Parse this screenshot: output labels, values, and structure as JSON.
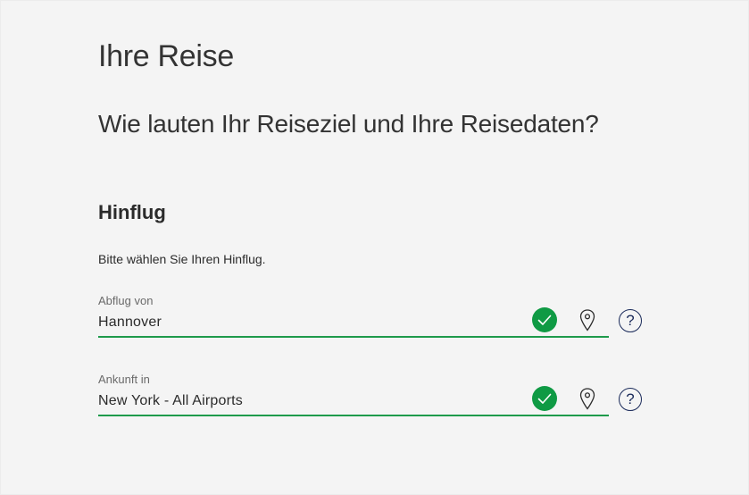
{
  "page": {
    "title": "Ihre Reise",
    "subtitle": "Wie lauten Ihr Reiseziel und Ihre Reisedaten?"
  },
  "outbound": {
    "section_title": "Hinflug",
    "instruction": "Bitte wählen Sie Ihren Hinflug.",
    "departure": {
      "label": "Abflug von",
      "value": "Hannover",
      "status": "valid"
    },
    "arrival": {
      "label": "Ankunft in",
      "value": "New York - All Airports",
      "status": "valid"
    },
    "help_symbol": "?"
  },
  "icons": {
    "valid": "check-circle-icon",
    "location": "map-pin-icon",
    "help": "question-circle-icon"
  },
  "colors": {
    "background": "#f4f4f4",
    "valid_green": "#0f9a44",
    "underline_green": "#1e9a4b",
    "help_navy": "#1a2a5a",
    "text": "#2b2b2b"
  }
}
